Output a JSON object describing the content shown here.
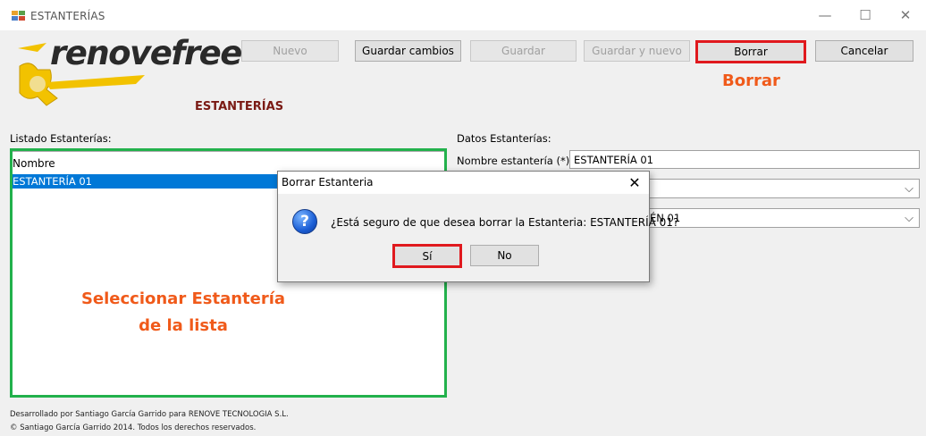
{
  "window": {
    "title": "ESTANTERÍAS",
    "minimize": "—",
    "maximize": "☐",
    "close": "✕"
  },
  "toolbar": {
    "nuevo": "Nuevo",
    "guardar_cambios": "Guardar cambios",
    "guardar": "Guardar",
    "guardar_y_nuevo": "Guardar y nuevo",
    "borrar": "Borrar",
    "cancelar": "Cancelar"
  },
  "logo": {
    "text": "renovefree"
  },
  "section_title": "ESTANTERÍAS",
  "annotations": {
    "borrar": "Borrar",
    "list_line1": "Seleccionar Estantería",
    "list_line2": "de la lista"
  },
  "list": {
    "label": "Listado Estanterías:",
    "column_header": "Nombre",
    "items": [
      "ESTANTERÍA 01"
    ],
    "selected_index": 0
  },
  "form": {
    "label": "Datos Estanterías:",
    "nombre_label": "Nombre estantería (*):",
    "nombre_value": "ESTANTERÍA 01",
    "combo1_value": "",
    "combo2_partial": "ÉN 01"
  },
  "dialog": {
    "title": "Borrar Estanteria",
    "message": "¿Está seguro de que desea borrar la Estanteria: ESTANTERÍA 01?",
    "yes": "Sí",
    "no": "No",
    "close": "✕"
  },
  "footer": {
    "line1": "Desarrollado por Santiago García Garrido para RENOVE TECNOLOGIA S.L.",
    "line2": "© Santiago García Garrido 2014. Todos los derechos reservados."
  },
  "colors": {
    "highlight_red": "#e0191e",
    "highlight_green": "#22b14c",
    "annotation_orange": "#f05a1a",
    "selection_blue": "#0078d7"
  }
}
